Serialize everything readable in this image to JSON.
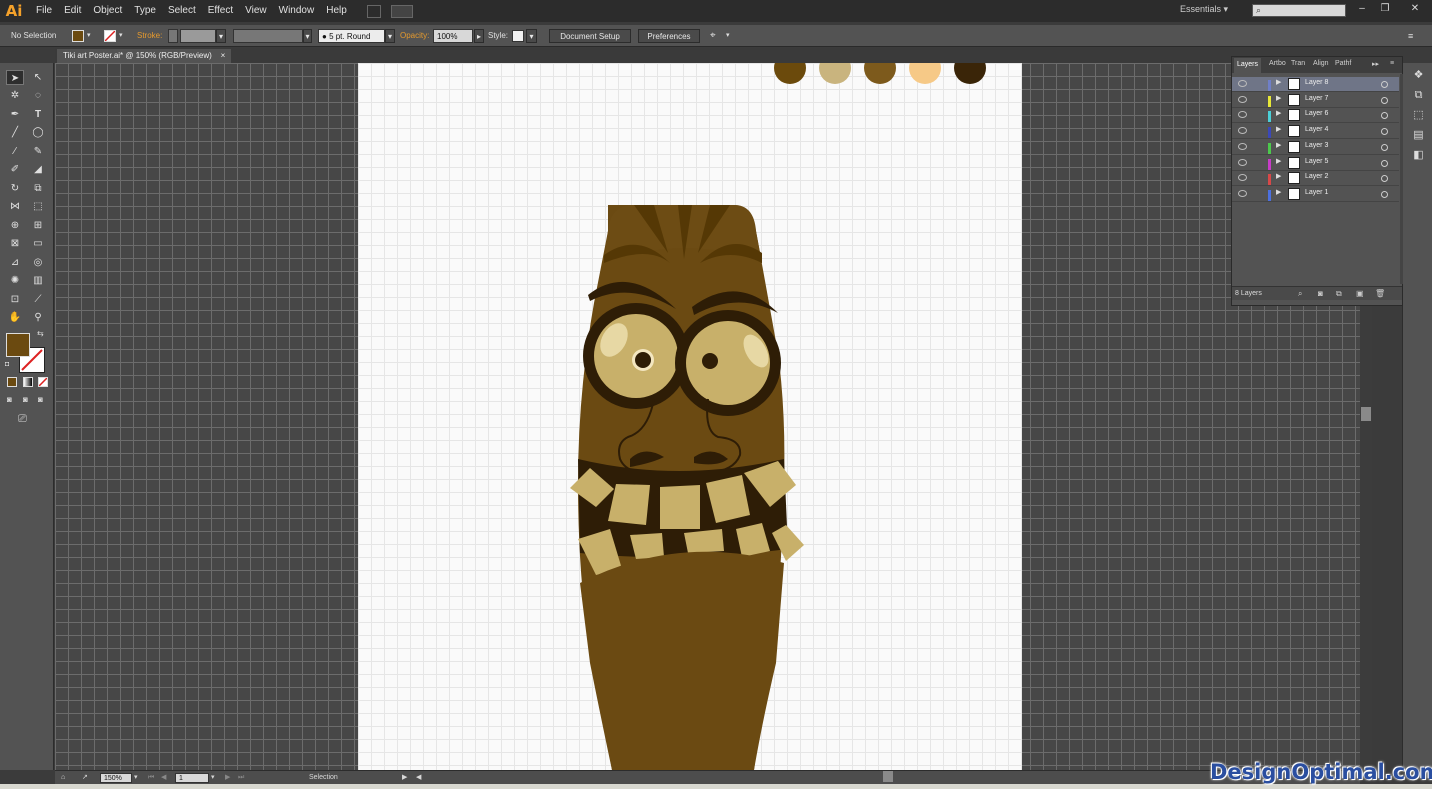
{
  "app": {
    "logo": "Ai"
  },
  "menu": [
    "File",
    "Edit",
    "Object",
    "Type",
    "Select",
    "Effect",
    "View",
    "Window",
    "Help"
  ],
  "workspace": {
    "label": "Essentials ▾"
  },
  "window_buttons": [
    "–",
    "❐",
    "✕"
  ],
  "control": {
    "selection_label": "No Selection",
    "stroke_label": "Stroke:",
    "brush_label": "5 pt. Round",
    "opacity_label": "Opacity:",
    "opacity_value": "100%",
    "style_label": "Style:",
    "document_setup": "Document Setup",
    "preferences": "Preferences"
  },
  "document_tab": {
    "title": "Tiki art Poster.ai* @ 150% (RGB/Preview)",
    "close": "×"
  },
  "layers_panel": {
    "tabs": [
      "Layers",
      "Artbo",
      "Tran",
      "Align",
      "Pathf"
    ],
    "layers": [
      {
        "name": "Layer 8",
        "color": "#6f7fc8",
        "selected": true
      },
      {
        "name": "Layer 7",
        "color": "#e8e838"
      },
      {
        "name": "Layer 6",
        "color": "#4bd0d8"
      },
      {
        "name": "Layer 4",
        "color": "#3b48b8"
      },
      {
        "name": "Layer 3",
        "color": "#4cc84c"
      },
      {
        "name": "Layer 5",
        "color": "#c83cc8"
      },
      {
        "name": "Layer 2",
        "color": "#d84848"
      },
      {
        "name": "Layer 1",
        "color": "#4c70e0"
      }
    ],
    "count": "8 Layers"
  },
  "status": {
    "zoom": "150%",
    "artboard": "1",
    "tool": "Selection"
  },
  "palette_swatches": [
    "#6b4a0c",
    "#c9b47e",
    "#7d5a1c",
    "#f6c987",
    "#3a2508"
  ],
  "colors": {
    "fill": "#6b4a10"
  },
  "watermark": "DesignOptimal.com"
}
